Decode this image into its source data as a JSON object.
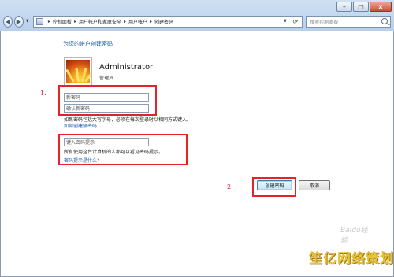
{
  "window": {
    "minimize_glyph": "–",
    "maximize_glyph": "□",
    "close_glyph": "x"
  },
  "nav": {
    "back_icon": "back-arrow-icon",
    "forward_icon": "forward-arrow-icon",
    "breadcrumbs": [
      "控制面板",
      "用户帐户和家庭安全",
      "用户帐户",
      "创建密码"
    ],
    "search_placeholder": "搜索控制面板"
  },
  "page": {
    "title": "为您的帐户创建密码",
    "user_name": "Administrator",
    "user_role": "管理员",
    "new_password_placeholder": "新密码",
    "confirm_password_placeholder": "确认新密码",
    "caps_notice": "如果密码包括大写字母，必须在每次登录时以相同方式键入。",
    "strong_password_link": "如何创建强密码",
    "hint_placeholder": "键入密码提示",
    "hint_notice": "所有使用这台计算机的人都可以看见密码提示。",
    "hint_help_link": "密码提示是什么?",
    "create_button": "创建密码",
    "cancel_button": "取消"
  },
  "annotations": {
    "marker_1": "1.",
    "marker_2": "2.",
    "color": "#e3222c"
  },
  "watermark": {
    "logo_text": "Baidu经验",
    "site_text": "笙亿网络策划"
  }
}
